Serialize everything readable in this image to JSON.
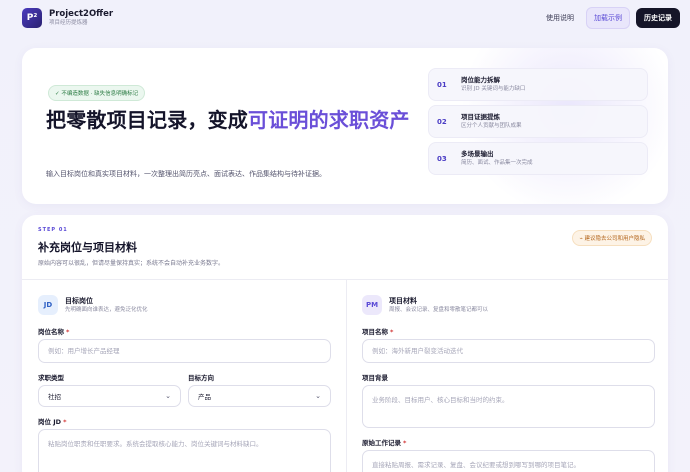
{
  "header": {
    "logo_text": "P²",
    "brand_name": "Project2Offer",
    "brand_sub": "项目经历提炼器",
    "nav": {
      "help": "使用说明",
      "example": "加载示例",
      "history": "历史记录"
    }
  },
  "hero": {
    "badge": "✓ 不编造数据 · 缺失信息明确标记",
    "title_plain": "把零散项目记录，变成",
    "title_accent": "可证明的求职资产",
    "description": "输入目标岗位和真实项目材料，一次整理出简历亮点、面试表达、作品集结构与待补证据。",
    "steps": [
      {
        "num": "01",
        "title": "岗位能力拆解",
        "sub": "识别 JD 关键词与能力缺口"
      },
      {
        "num": "02",
        "title": "项目证据提炼",
        "sub": "区分个人贡献与团队成果"
      },
      {
        "num": "03",
        "title": "多场景输出",
        "sub": "简历、面试、作品集一次完成"
      }
    ]
  },
  "form": {
    "step_label": "STEP 01",
    "title": "补充岗位与项目材料",
    "subtitle": "原始内容可以很乱，但请尽量保持真实；系统不会自动补充业务数字。",
    "warning": "⌁ 建议隐去公司和用户隐私",
    "target": {
      "avatar": "JD",
      "title": "目标岗位",
      "subtitle": "先明确面向谁表达，避免泛化优化",
      "job_name_label": "岗位名称",
      "job_name_placeholder": "例如：用户增长产品经理",
      "type_label": "求职类型",
      "type_value": "社招",
      "direction_label": "目标方向",
      "direction_value": "产品",
      "jd_label": "岗位 JD",
      "jd_placeholder": "粘贴岗位职责和任职要求。系统会提取核心能力、岗位关键词与材料缺口。"
    },
    "project": {
      "avatar": "PM",
      "title": "项目材料",
      "subtitle": "周报、会议记录、复盘和零散笔记都可以",
      "name_label": "项目名称",
      "name_placeholder": "例如：海外新用户裂变活动迭代",
      "background_label": "项目背景",
      "background_placeholder": "业务阶段、目标用户、核心目标和当时的约束。",
      "log_label": "原始工作记录",
      "log_placeholder": "直接粘贴周报、需求记录、复盘、会议纪要或想到哪写到哪的项目笔记。"
    },
    "required_mark": "*"
  }
}
